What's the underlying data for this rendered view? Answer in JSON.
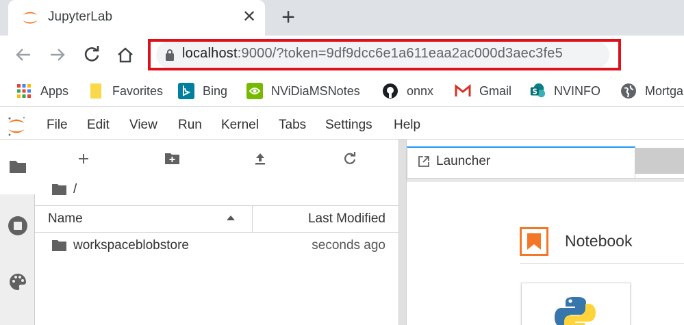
{
  "browser": {
    "tab": {
      "title": "JupyterLab",
      "favicon": "jupyter-logo-icon",
      "close_glyph": "✕"
    },
    "new_tab_glyph": "+",
    "toolbar": {
      "back": "back-arrow-icon",
      "forward": "forward-arrow-icon",
      "reload": "reload-icon",
      "home": "home-icon"
    },
    "url": {
      "host": "localhost",
      "rest": ":9000/?token=9df9dcc6e1a611eaa2ac000d3aec3fe5"
    },
    "highlight_color": "#e0101a",
    "bookmarks": [
      {
        "label": "Apps",
        "icon": "apps-grid-icon"
      },
      {
        "label": "Favorites",
        "icon": "folder-icon"
      },
      {
        "label": "Bing",
        "icon": "bing-icon"
      },
      {
        "label": "NViDiaMSNotes",
        "icon": "nvidia-icon"
      },
      {
        "label": "onnx",
        "icon": "github-icon"
      },
      {
        "label": "Gmail",
        "icon": "gmail-icon"
      },
      {
        "label": "NVINFO",
        "icon": "sharepoint-icon"
      },
      {
        "label": "Mortga",
        "icon": "globe-icon"
      }
    ]
  },
  "jupyter": {
    "menu": [
      "File",
      "Edit",
      "View",
      "Run",
      "Kernel",
      "Tabs",
      "Settings",
      "Help"
    ],
    "sidebar_tabs": [
      "folder-icon",
      "running-stop-icon",
      "palette-icon"
    ],
    "filebrowser": {
      "toolbar": [
        "new-launcher-icon",
        "new-folder-icon",
        "upload-icon",
        "refresh-icon"
      ],
      "breadcrumb": "/",
      "columns": {
        "name": "Name",
        "modified": "Last Modified"
      },
      "items": [
        {
          "name": "workspaceblobstore",
          "modified": "seconds ago",
          "type": "folder"
        }
      ]
    },
    "dock": {
      "tab_label": "Launcher",
      "section_title": "Notebook",
      "accent": "#f37726",
      "tab_accent": "#2196f3"
    }
  }
}
